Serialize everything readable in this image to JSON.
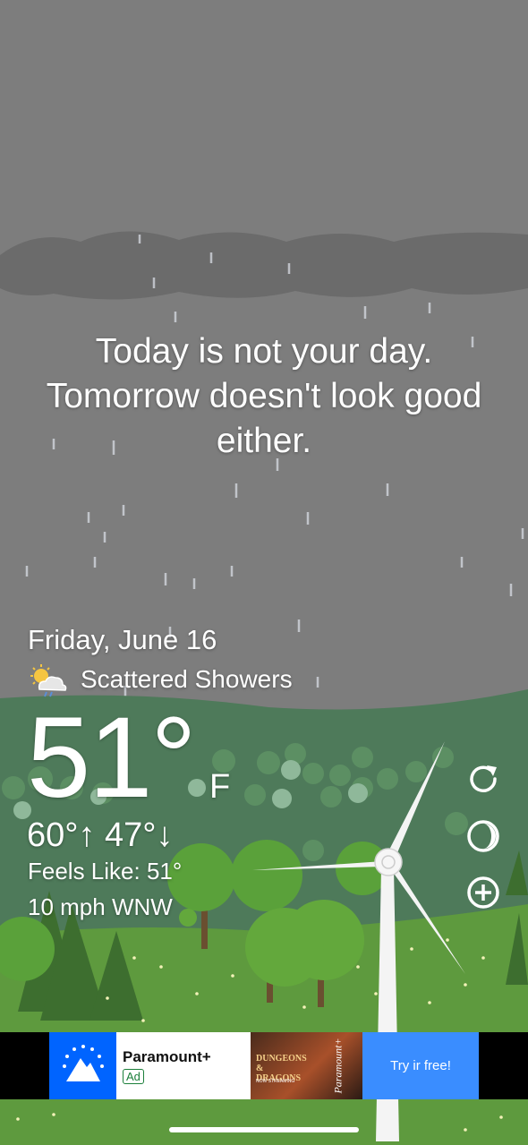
{
  "headline": {
    "line1": "Today is not your day.",
    "line2": "Tomorrow doesn't look good",
    "line3": "either."
  },
  "weather": {
    "date": "Friday, June 16",
    "condition": "Scattered Showers",
    "condition_icon": "sun-cloud-rain-icon",
    "temperature": "51°",
    "unit": "F",
    "high_low": "60°↑ 47°↓",
    "feels_like": "Feels Like: 51°",
    "wind": "10 mph WNW"
  },
  "controls": [
    {
      "name": "refresh-icon"
    },
    {
      "name": "moon-phase-icon"
    },
    {
      "name": "add-location-icon"
    }
  ],
  "ad": {
    "title": "Paramount+",
    "badge": "Ad",
    "image_title": "DUNGEONS & DRAGONS",
    "image_subtitle": "NOW STREAMING",
    "image_brand": "Paramount+",
    "cta": "Try ir free!"
  },
  "colors": {
    "sky": "#7d7d7d",
    "cloud": "#6b6b6b",
    "hill": "#4e7a5a",
    "grass": "#5e9a3e",
    "tree": "#5aa13a",
    "ad_blue": "#0064ff",
    "cta_blue": "#3a8dff"
  }
}
